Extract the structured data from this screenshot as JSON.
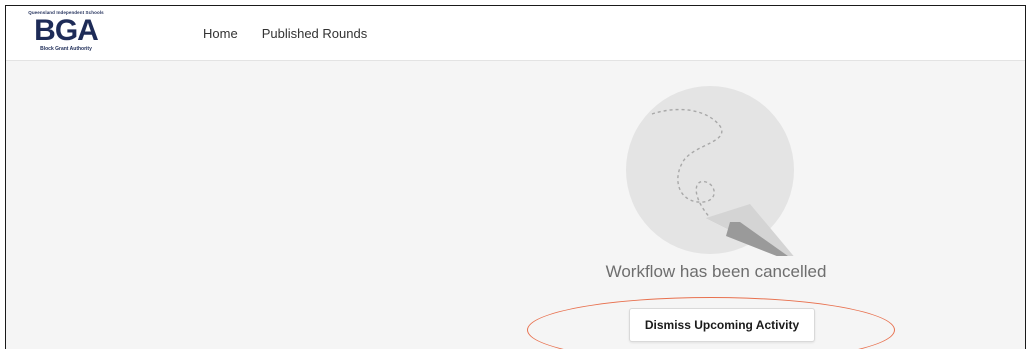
{
  "logo": {
    "top_text": "Queensland Independent Schools",
    "main_text": "BGA",
    "bottom_text": "Block Grant Authority"
  },
  "nav": {
    "items": [
      {
        "label": "Home"
      },
      {
        "label": "Published Rounds"
      }
    ]
  },
  "main": {
    "illustration_icon": "paper-plane-icon",
    "message": "Workflow has been cancelled",
    "dismiss_button_label": "Dismiss Upcoming Activity"
  },
  "colors": {
    "brand": "#1d2b57",
    "highlight": "#e8714f",
    "background": "#f5f5f5"
  }
}
